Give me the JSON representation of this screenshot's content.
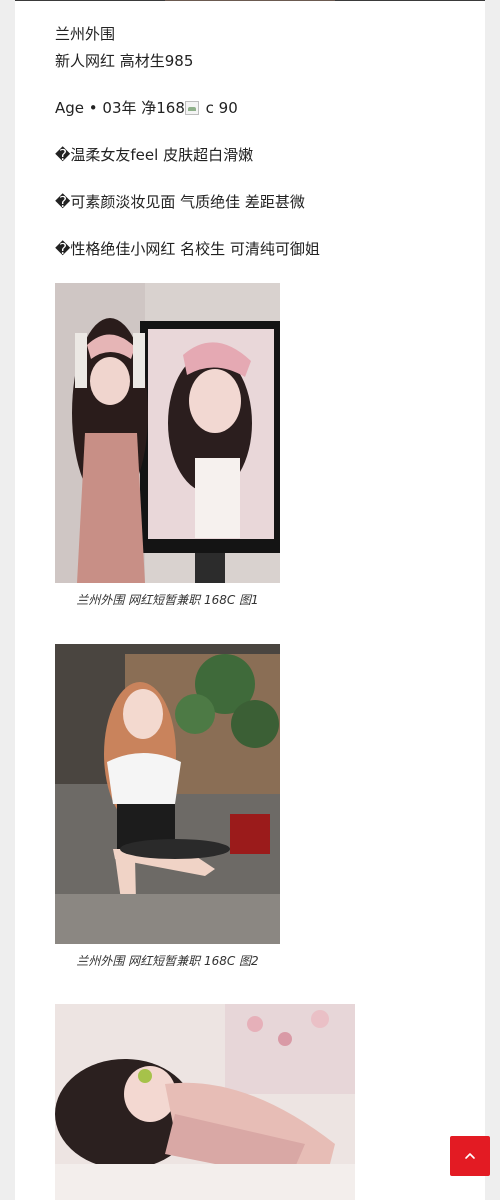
{
  "post": {
    "location": "兰州外围",
    "headline": "新人网红 高材生985",
    "stats_prefix": "Age • 03年  净168",
    "stats_suffix": " c  90",
    "trait_1": "温柔女友feel   皮肤超白滑嫩",
    "trait_2": "可素颜淡妆见面 气质绝佳  差距甚微",
    "trait_3": "性格绝佳小网红 名校生 可清纯可御姐",
    "bullet_glyph": "�"
  },
  "figures": [
    {
      "caption": "兰州外围 网红短暂兼职 168C 图1"
    },
    {
      "caption": "兰州外围 网红短暂兼职 168C 图2"
    },
    {
      "caption": ""
    }
  ],
  "colors": {
    "scroll_button": "#e31b23",
    "page_bg": "#eeeeee",
    "card_bg": "#ffffff"
  },
  "icons": {
    "scroll_top": "chevron-up-icon",
    "broken_image": "broken-image-icon"
  }
}
